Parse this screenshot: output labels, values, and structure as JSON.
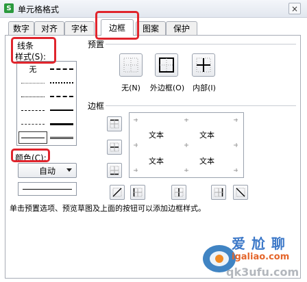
{
  "window": {
    "title": "单元格格式",
    "app_icon": "S",
    "close_glyph": "×"
  },
  "tabs": [
    {
      "label": "数字"
    },
    {
      "label": "对齐"
    },
    {
      "label": "字体"
    },
    {
      "label": "边框",
      "active": true
    },
    {
      "label": "图案"
    },
    {
      "label": "保护"
    }
  ],
  "line": {
    "group_label": "线条",
    "style_label": "样式(S):",
    "none_label": "无",
    "color_label": "颜色(C):",
    "color_value": "自动"
  },
  "presets": {
    "group_label": "预置",
    "items": [
      {
        "label": "无(N)",
        "icon": "border-none-icon"
      },
      {
        "label": "外边框(O)",
        "icon": "border-outline-icon"
      },
      {
        "label": "内部(I)",
        "icon": "border-inside-icon"
      }
    ]
  },
  "border": {
    "group_label": "边框",
    "preview_texts": [
      "文本",
      "文本",
      "文本",
      "文本"
    ]
  },
  "description": "单击预置选项、预览草图及上面的按钮可以添加边框样式。",
  "watermark": {
    "line1": "爱 尬 聊",
    "line2": "igaliao.com",
    "line3": "qk3ufu.com"
  },
  "colors": {
    "highlight": "#e0242c",
    "title_icon": "#2b9a3e"
  }
}
